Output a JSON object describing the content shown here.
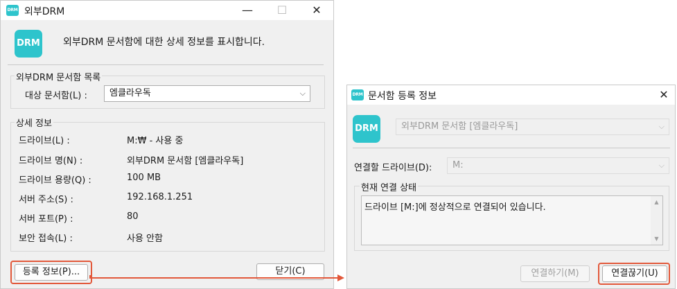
{
  "win1": {
    "title": "외부DRM",
    "icon_text": "DRM",
    "description": "외부DRM 문서함에 대한 상세 정보를 표시합니다.",
    "list_group_label": "외부DRM 문서함 목록",
    "target_label": "대상 문서함(L) :",
    "target_value": "엠클라우독",
    "detail_group_label": "상세 정보",
    "details": [
      {
        "label": "드라이브(L) :",
        "value": "M:₩ - 사용 중"
      },
      {
        "label": "드라이브 명(N) :",
        "value": "외부DRM 문서함 [엠클라우독]"
      },
      {
        "label": "드라이브 용량(Q) :",
        "value": "100 MB"
      },
      {
        "label": "서버 주소(S) :",
        "value": "192.168.1.251"
      },
      {
        "label": "서버 포트(P) :",
        "value": "80"
      },
      {
        "label": "보안 접속(L) :",
        "value": "사용 안함"
      }
    ],
    "register_info_button": "등록 정보(P)...",
    "close_button": "닫기(C)"
  },
  "win2": {
    "title": "문서함 등록 정보",
    "icon_text": "DRM",
    "box_combo_value": "외부DRM 문서함 [엠클라우독]",
    "drive_label": "연결할 드라이브(D):",
    "drive_value": "M:",
    "status_group_label": "현재 연결 상태",
    "status_text": "드라이브 [M:]에 정상적으로 연결되어 있습니다.",
    "connect_button": "연결하기(M)",
    "disconnect_button": "연결끊기(U)"
  },
  "colors": {
    "accent": "#2ec4cc",
    "highlight": "#e2583a"
  }
}
